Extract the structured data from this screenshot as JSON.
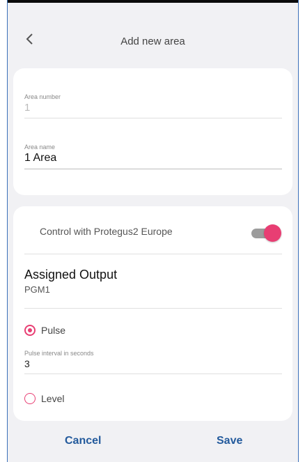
{
  "header": {
    "title": "Add new area",
    "back_icon": "chevron-left-icon"
  },
  "area_number": {
    "label": "Area number",
    "value": "1"
  },
  "area_name": {
    "label": "Area name",
    "value": "1 Area"
  },
  "control": {
    "label": "Control with Protegus2 Europe",
    "enabled": true
  },
  "assigned_output": {
    "title": "Assigned Output",
    "value": "PGM1"
  },
  "mode": {
    "pulse_label": "Pulse",
    "pulse_selected": true,
    "interval_label": "Pulse interval in seconds",
    "interval_value": "3",
    "level_label": "Level",
    "level_selected": false
  },
  "footer": {
    "cancel_label": "Cancel",
    "save_label": "Save"
  },
  "colors": {
    "accent": "#e83e73",
    "button_text": "#235a9c",
    "background": "#f1f1f4"
  }
}
